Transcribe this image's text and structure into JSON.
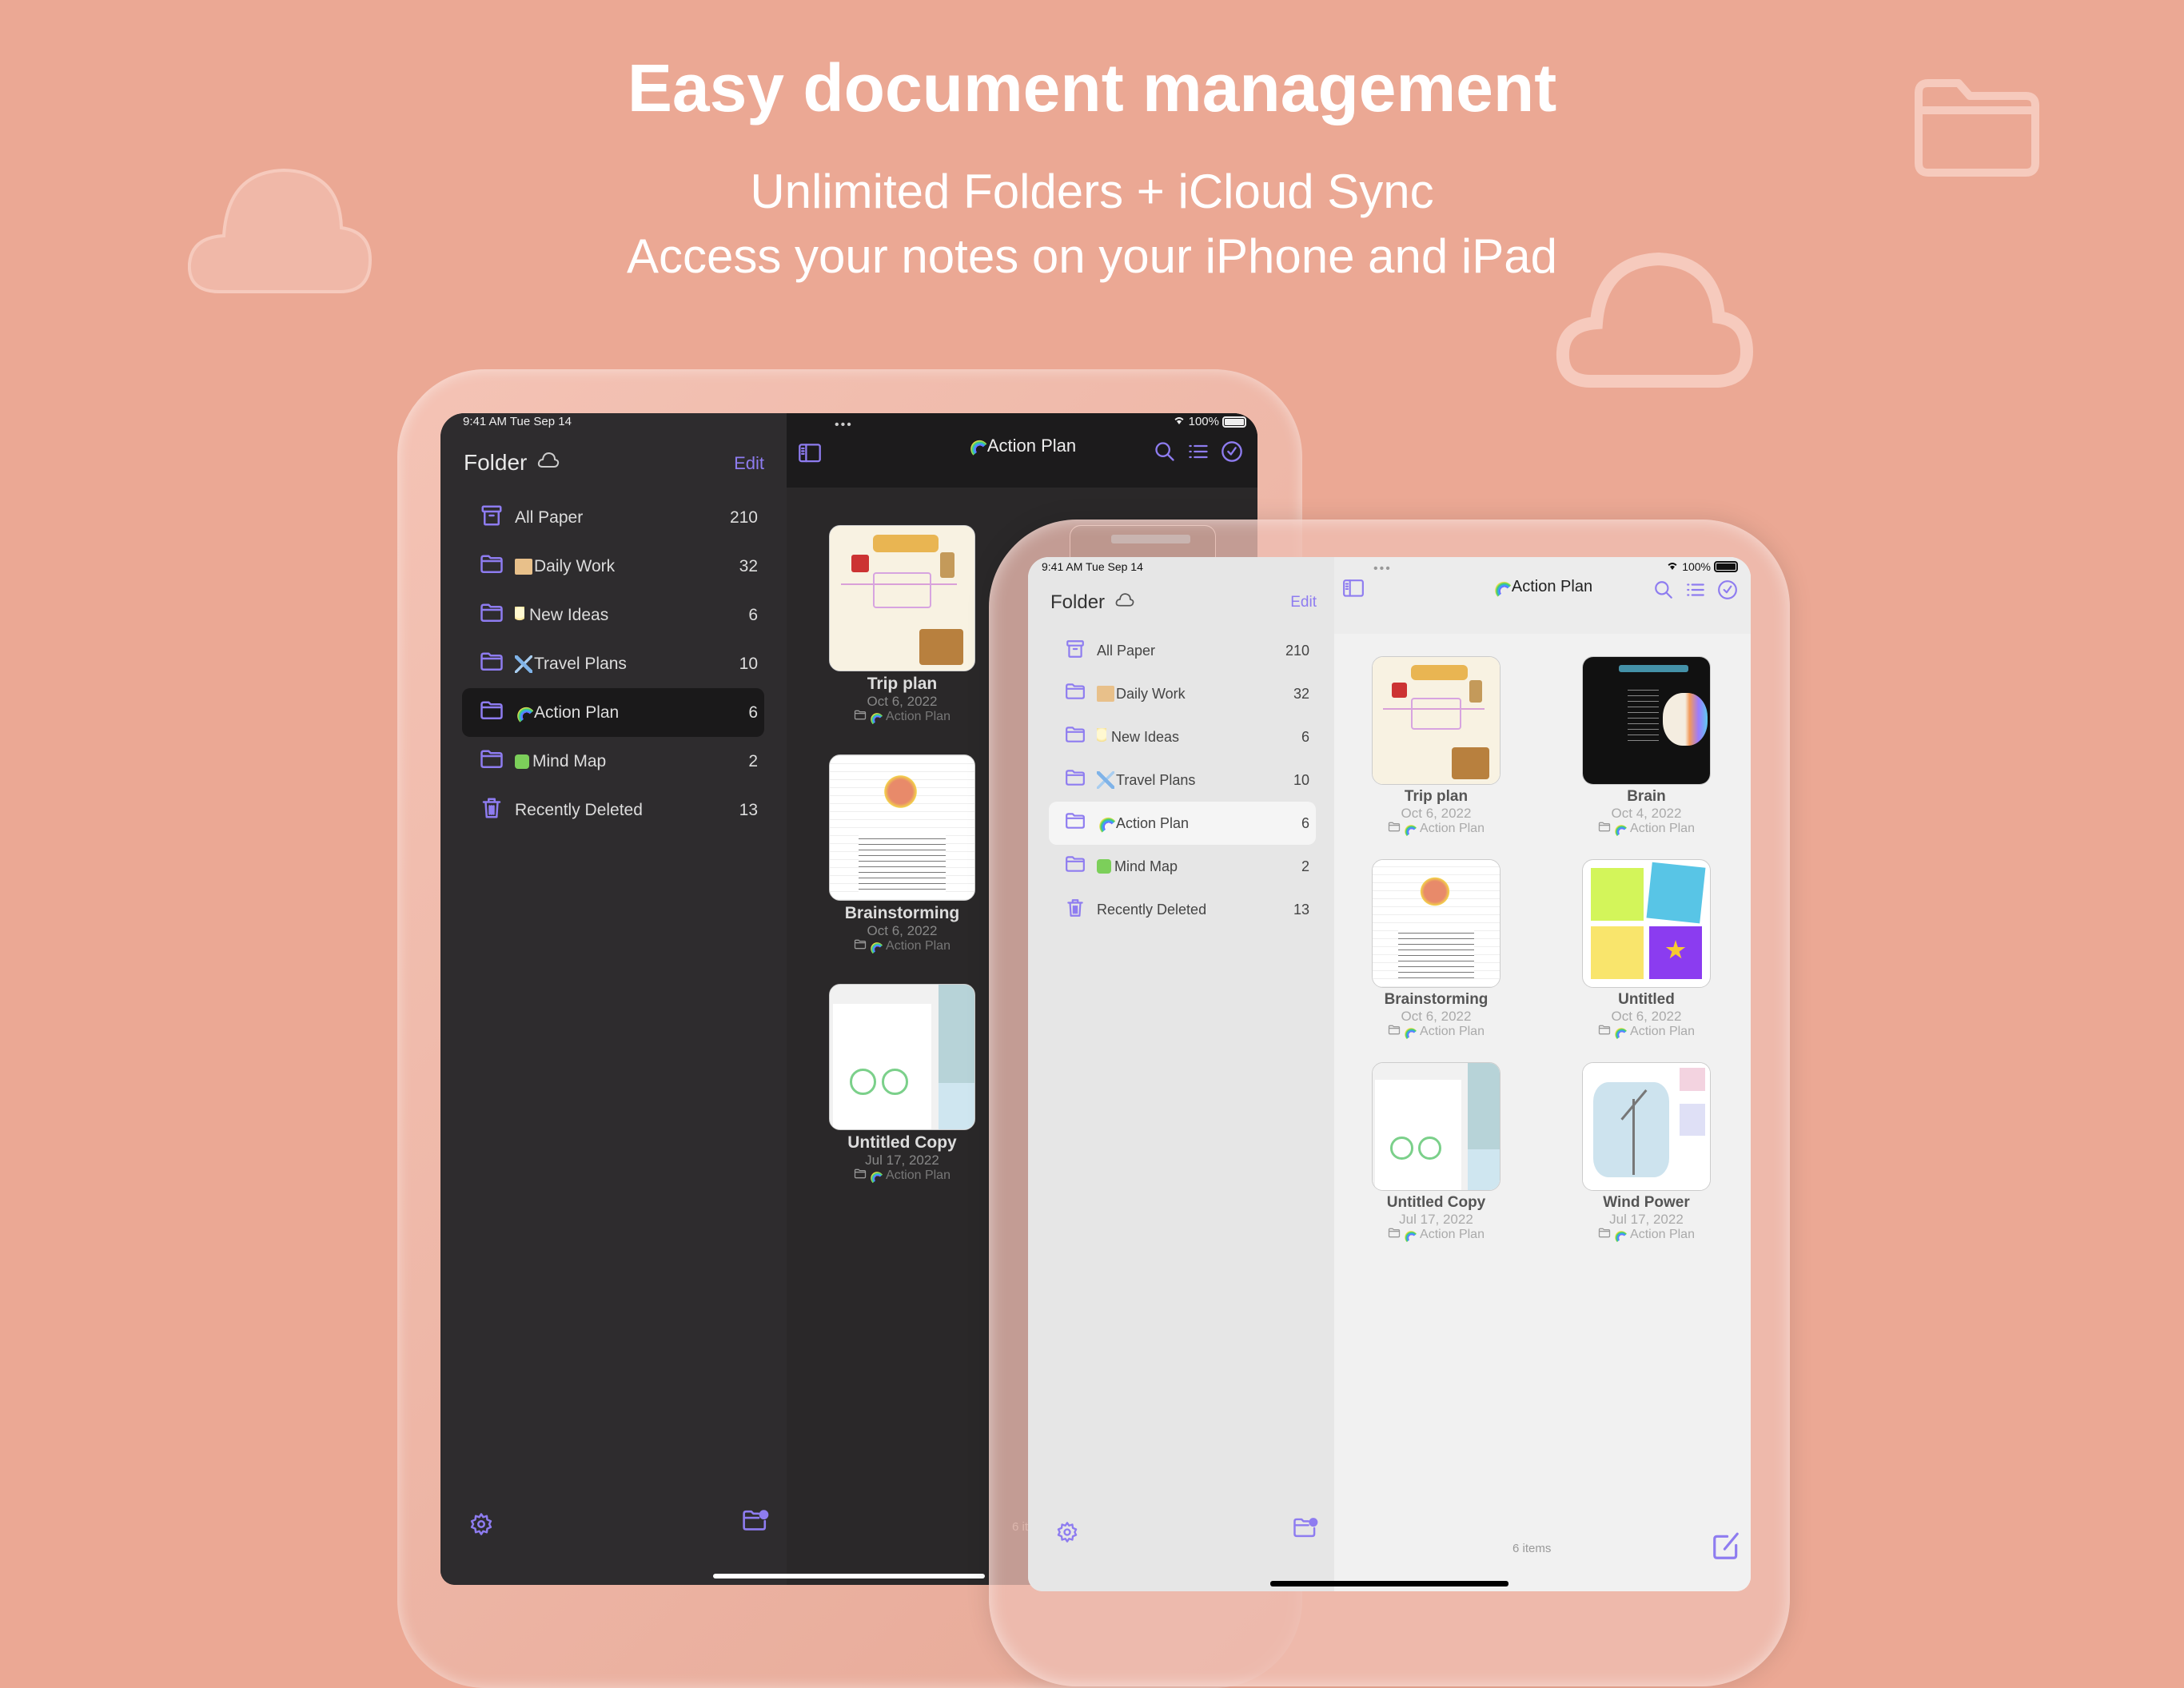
{
  "hero": {
    "title": "Easy document management",
    "subtitle1": "Unlimited Folders + iCloud Sync",
    "subtitle2": "Access your notes on your iPhone and iPad"
  },
  "colors": {
    "background": "#eba894",
    "accent": "#8e7cf0"
  },
  "status": {
    "time": "9:41 AM  Tue Sep 14",
    "battery": "100%"
  },
  "sidebar": {
    "title": "Folder",
    "edit_label": "Edit",
    "items": [
      {
        "label": "All Paper",
        "count": "210",
        "icon": "archive-icon",
        "emoji": ""
      },
      {
        "label": "Daily Work",
        "count": "32",
        "icon": "folder-icon",
        "emoji": "box"
      },
      {
        "label": "New Ideas",
        "count": "6",
        "icon": "folder-icon",
        "emoji": "bulb"
      },
      {
        "label": "Travel Plans",
        "count": "10",
        "icon": "folder-icon",
        "emoji": "plane"
      },
      {
        "label": "Action Plan",
        "count": "6",
        "icon": "folder-icon",
        "emoji": "rainbow",
        "selected": true
      },
      {
        "label": "Mind Map",
        "count": "2",
        "icon": "folder-icon",
        "emoji": "puzzle"
      },
      {
        "label": "Recently Deleted",
        "count": "13",
        "icon": "trash-icon",
        "emoji": ""
      }
    ]
  },
  "main": {
    "title": "Action Plan",
    "items_count": "6 items",
    "cards": [
      {
        "title": "Trip plan",
        "date": "Oct 6, 2022",
        "folder": "Action Plan",
        "thumbnail": "travel-map"
      },
      {
        "title": "Brain",
        "date": "Oct 4, 2022",
        "folder": "Action Plan",
        "thumbnail": "left-brain"
      },
      {
        "title": "Brainstorming",
        "date": "Oct 6, 2022",
        "folder": "Action Plan",
        "thumbnail": "brainstorm-text"
      },
      {
        "title": "Untitled",
        "date": "Oct 6, 2022",
        "folder": "Action Plan",
        "thumbnail": "sticky-notes"
      },
      {
        "title": "Untitled Copy",
        "date": "Jul 17, 2022",
        "folder": "Action Plan",
        "thumbnail": "document"
      },
      {
        "title": "Wind Power",
        "date": "Jul 17, 2022",
        "folder": "Action Plan",
        "thumbnail": "wind-turbine"
      }
    ],
    "dark_visible_cards": [
      0,
      2,
      4
    ]
  }
}
